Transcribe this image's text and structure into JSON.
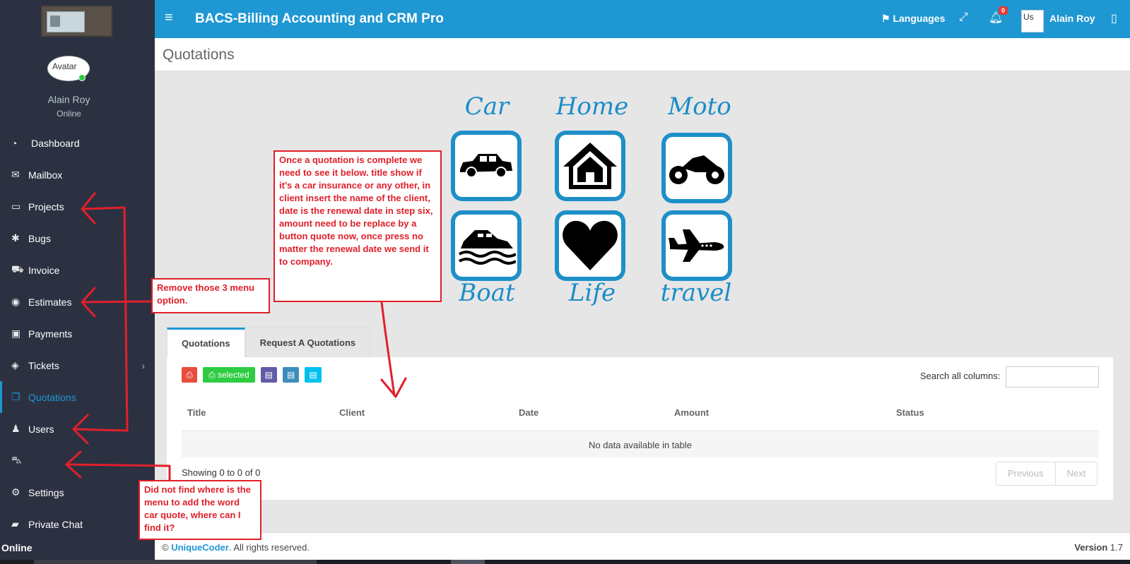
{
  "header": {
    "app_title": "BACS-Billing Accounting and CRM Pro",
    "languages_label": "Languages",
    "notification_count": "0",
    "user_avatar_alt": "Us",
    "user_name": "Alain Roy"
  },
  "sidebar": {
    "avatar_alt": "Avatar",
    "user_name": "Alain Roy",
    "user_status": "Online",
    "items": [
      {
        "label": "Dashboard",
        "icon": "tachometer-icon"
      },
      {
        "label": "Mailbox",
        "icon": "envelope-icon"
      },
      {
        "label": "Projects",
        "icon": "folder-open-icon"
      },
      {
        "label": "Bugs",
        "icon": "bug-icon"
      },
      {
        "label": "Invoice",
        "icon": "cart-icon"
      },
      {
        "label": "Estimates",
        "icon": "dashboard-icon"
      },
      {
        "label": "Payments",
        "icon": "money-icon"
      },
      {
        "label": "Tickets",
        "icon": "ticket-icon"
      },
      {
        "label": "Quotations",
        "icon": "copy-icon"
      },
      {
        "label": "Users",
        "icon": "users-icon"
      },
      {
        "label": "",
        "icon": "car-icon"
      },
      {
        "label": "Settings",
        "icon": "cogs-icon"
      },
      {
        "label": "Private Chat",
        "icon": "comment-icon"
      }
    ],
    "footer_status": "Online"
  },
  "page": {
    "title": "Quotations"
  },
  "insurance": {
    "car": "Car",
    "home": "Home",
    "moto": "Moto",
    "boat": "Boat",
    "life": "Life",
    "travel": "travel"
  },
  "tabs": {
    "quotations": "Quotations",
    "request": "Request A Quotations"
  },
  "table": {
    "selected_label": "selected",
    "search_label": "Search all columns:",
    "search_value": "",
    "columns": [
      "Title",
      "Client",
      "Date",
      "Amount",
      "Status"
    ],
    "empty_message": "No data available in table",
    "info": "Showing 0 to 0 of 0",
    "previous": "Previous",
    "next": "Next"
  },
  "footer": {
    "copyright_symbol": "©",
    "company": "UniqueCoder",
    "rights": ". All rights reserved.",
    "version_label": "Version",
    "version_value": "1.7"
  },
  "annotations": {
    "quotation_note": "Once a quotation is complete we need to see it below. title show if it's a car insurance or any other, in client insert the name of the client, date is the renewal date in step six, amount need to be replace by a button quote now, once press no matter the renewal date we send it to company.",
    "remove_note": "Remove those 3 menu option.",
    "car_quote_note": "Did not find where is the menu to add the word car quote, where can I find it?"
  },
  "colors": {
    "header_bg": "#1e97d2",
    "sidebar_bg": "#2c3142",
    "annotation_red": "#e0202a"
  }
}
